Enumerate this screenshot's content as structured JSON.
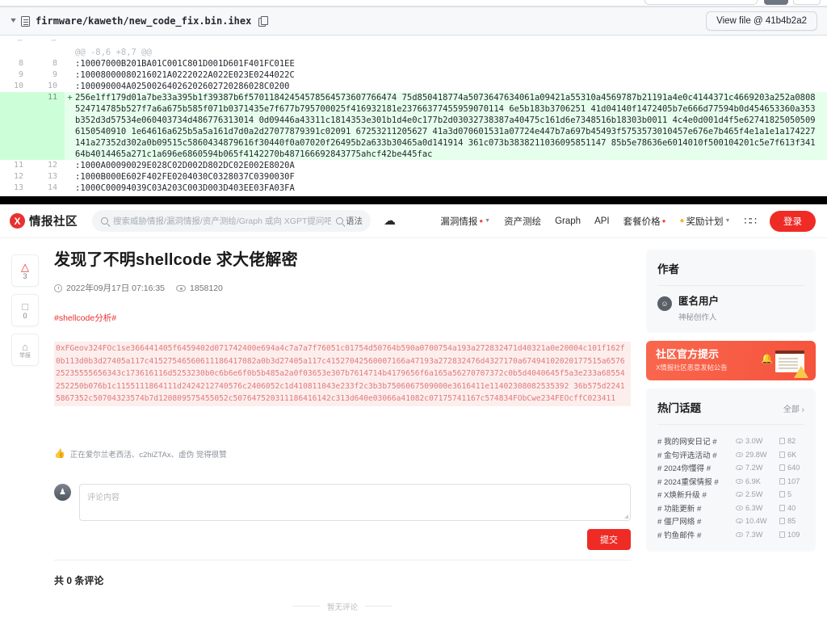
{
  "diff": {
    "file_path": "firmware/kaweth/new_code_fix.bin.ihex",
    "view_file_label": "View file @ 41b4b2a2",
    "hunk_header": "@@ -8,6 +8,7 @@",
    "rows": [
      {
        "old": "...",
        "new": "...",
        "sign": "",
        "type": "dots",
        "code": ""
      },
      {
        "old": "",
        "new": "",
        "sign": "",
        "type": "hunk",
        "code": "@@ -8,6 +8,7 @@"
      },
      {
        "old": "8",
        "new": "8",
        "sign": "",
        "type": "ctx",
        "code": ":10007000B201BA01C001C801D001D601F401FC01EE"
      },
      {
        "old": "9",
        "new": "9",
        "sign": "",
        "type": "ctx",
        "code": ":10008000080216021A0222022A022E023E0244022C"
      },
      {
        "old": "10",
        "new": "10",
        "sign": "",
        "type": "ctx",
        "code": ":100090004A02500264026202602720286028C0200"
      },
      {
        "old": "",
        "new": "11",
        "sign": "+",
        "type": "add",
        "code": "256e1ff179d01a7be33a395b1f39387b6f57011842454578564573607766474 75d850418774a5073647634061a09421a55310a4569787b21191a4e0c4144371c4669203a252a0808524714785b527f7a6a675b585f071b0371435e7f677b795700025f416932181e23766377455959070114 6e5b183b3706251 41d04140f1472405b7e666d77594b0d454653360a353b352d3d57534e060403734d486776313014 0d09446a43311c1814353e301b1d4e0c177b2d03032738387a40475c161d6e7348516b18303b0011 4c4e0d001d4f5e627418250505096150540910 1e64616a625b5a5a161d7d0a2d27077879391c02091 67253211205627 41a3d070601531a07724e447b7a697b45493f5753573010457e676e7b465f4e1a1e1a174227141a27352d302a0b09515c5860434879616f30440f0a07020f26495b2a633b30465a0d141914 361c073b3838211036095851147 85b5e78636e6014010f500104201c5e7f613f34164b4014465a271c1a696e6860594b065f4142270b487166692843775ahcf42be445fac"
      },
      {
        "old": "11",
        "new": "12",
        "sign": "",
        "type": "ctx",
        "code": ":1000A00090029E028C02D002D802DC02E002E8020A"
      },
      {
        "old": "12",
        "new": "13",
        "sign": "",
        "type": "ctx",
        "code": ":1000B000E602F402FE0204030C0328037C0390030F"
      },
      {
        "old": "13",
        "new": "14",
        "sign": "",
        "type": "ctx",
        "code": ":1000C00094039C03A203C003D003D403EE03FA03FA"
      },
      {
        "old": "...",
        "new": "...",
        "sign": "",
        "type": "dots",
        "code": ""
      }
    ]
  },
  "nav": {
    "brand_mark": "X",
    "brand_text": "情报社区",
    "search_placeholder": "搜索威胁情报/漏洞情报/资产测绘/Graph 或向 XGPT提问吧~",
    "syntax_label": "语法",
    "upload_icon": "upload-cloud-icon",
    "items": [
      {
        "label": "漏洞情报",
        "hot": true,
        "caret": true
      },
      {
        "label": "资产测绘",
        "hot": false,
        "caret": false
      },
      {
        "label": "Graph",
        "hot": false,
        "caret": false
      },
      {
        "label": "API",
        "hot": false,
        "caret": false
      },
      {
        "label": "套餐价格",
        "hot": true,
        "caret": false
      },
      {
        "label": "奖励计划",
        "hot": false,
        "caret": true,
        "coin": true
      }
    ],
    "grid_icon": "apps-grid-icon",
    "login_label": "登录"
  },
  "rail": [
    {
      "icon": "thumbs-up-icon",
      "glyph": "△",
      "count": "3",
      "label": ""
    },
    {
      "icon": "comment-icon",
      "glyph": "□",
      "count": "0",
      "label": ""
    },
    {
      "icon": "alarm-report-icon",
      "glyph": "⌂",
      "count": "",
      "label": "举报"
    }
  ],
  "post": {
    "title": "发现了不明shellcode 求大佬解密",
    "date": "2022年09月17日 07:16:35",
    "views": "1858120",
    "tag": "#shellcode分析#",
    "shellcode": "0xFGeov324FOc1se366441405f6459402d071742400e694a4c7a7a7f76051c01754d50764b590a0700754a193a272832471d40321a0e20004c101f162f0b113d0b3d27405a117c41527546560611186417082a0b3d27405a117c41527042560007166a47193a272832476d4327170a67494102020177515a657625235555656343c173616116d5253230b0c6b6e6f0b5b485a2a0f03653e307b7614714b4179656f6a165a56270707372c0b5d4040645f5a3e233a68554252250b076b1c1155111864111d2424212740576c2406052c1d410811043e233f2c3b3b7506067509000e3616411e11402308082535392 36b575d22415867352c50704323574b7d120809575455052c507647520311186416142c313d640e03066a41082c07175741167c574834FObCwe234FEOcffC023411",
    "footer_note": "正在爱尔兰老西活、c2hiZTAx、虚伪 觉得很赞"
  },
  "comments": {
    "placeholder": "评论内容",
    "submit_label": "提交",
    "count_label": "共 0 条评论",
    "empty_label": "暂无评论",
    "avatar_glyph": "♟"
  },
  "sidebar": {
    "author_card": {
      "title": "作者",
      "name": "匿名用户",
      "desc": "神秘创作人",
      "avatar_glyph": "☺"
    },
    "notice": {
      "title": "社区官方提示",
      "subtitle": "X情报社区恶意发帖公告"
    },
    "topics": {
      "title": "热门话题",
      "all_label": "全部",
      "chevron": "›",
      "items": [
        {
          "name": "# 我的网安日记 #",
          "views": "3.0W",
          "posts": "82"
        },
        {
          "name": "# 金句评选活动 #",
          "views": "29.8W",
          "posts": "6K"
        },
        {
          "name": "# 2024你懂得 #",
          "views": "7.2W",
          "posts": "640"
        },
        {
          "name": "# 2024重保情报 #",
          "views": "6.9K",
          "posts": "107"
        },
        {
          "name": "# X焕新升级 #",
          "views": "2.5W",
          "posts": "5"
        },
        {
          "name": "# 功能更新 #",
          "views": "6.3W",
          "posts": "40"
        },
        {
          "name": "# 僵尸网络 #",
          "views": "10.4W",
          "posts": "85"
        },
        {
          "name": "# 钓鱼邮件 #",
          "views": "7.3W",
          "posts": "109"
        }
      ]
    }
  }
}
